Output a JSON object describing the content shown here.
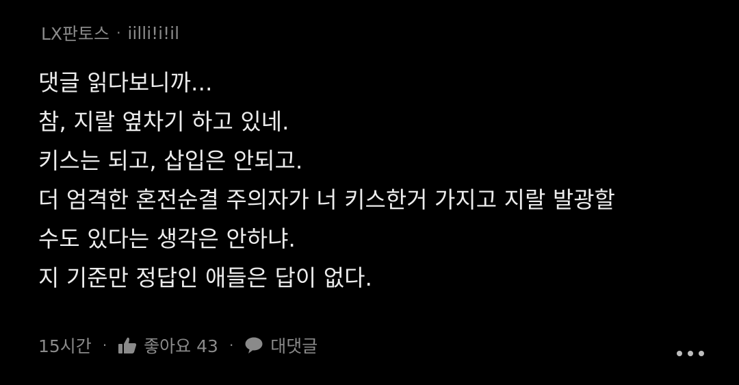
{
  "comment": {
    "author": "LX판토스",
    "separator": "·",
    "nickname": "iilli!i!il",
    "body_lines": [
      "댓글 읽다보니까...",
      "참, 지랄 옆차기 하고 있네.",
      "키스는 되고, 삽입은 안되고.",
      "더 엄격한 혼전순결 주의자가 너 키스한거 가지고 지랄 발광할",
      "수도 있다는 생각은 안하냐.",
      "지 기준만 정답인 애들은 답이 없다."
    ],
    "time": "15시간",
    "like_label": "좋아요 43",
    "reply_label": "대댓글",
    "dot": "·",
    "icons": {
      "like": "thumbs-up-icon",
      "reply": "speech-bubble-icon",
      "more": "more-dots-icon"
    }
  },
  "colors": {
    "background": "#000000",
    "text": "#ececec",
    "muted": "#8a8a8a"
  }
}
